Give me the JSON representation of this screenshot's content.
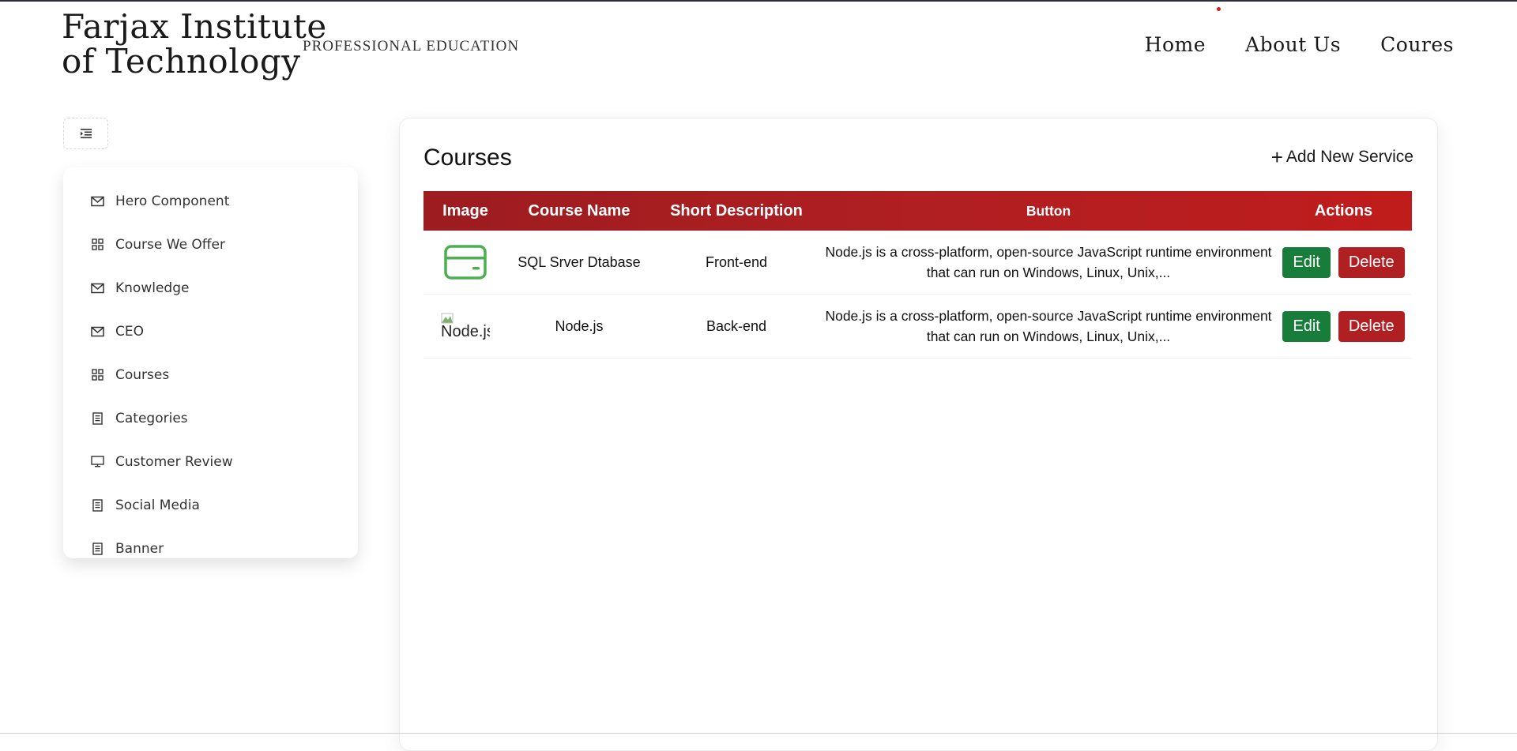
{
  "header": {
    "brand_line1": "Farjax Institute",
    "brand_line2": "of Technology",
    "tagline": "PROFESSIONAL EDUCATION",
    "nav": [
      "Home",
      "About Us",
      "Coures"
    ]
  },
  "sidebar": {
    "items": [
      {
        "label": "Hero Component",
        "icon": "mail-icon"
      },
      {
        "label": "Course We Offer",
        "icon": "grid-icon"
      },
      {
        "label": "Knowledge",
        "icon": "mail-icon"
      },
      {
        "label": "CEO",
        "icon": "mail-icon"
      },
      {
        "label": "Courses",
        "icon": "grid-icon"
      },
      {
        "label": "Categories",
        "icon": "document-icon"
      },
      {
        "label": "Customer Review",
        "icon": "monitor-icon"
      },
      {
        "label": "Social Media",
        "icon": "document-icon"
      },
      {
        "label": "Banner",
        "icon": "document-icon"
      }
    ]
  },
  "main": {
    "title": "Courses",
    "add_label": "Add New Service",
    "columns": [
      "Image",
      "Course Name",
      "Short Description",
      "Button",
      "Actions"
    ],
    "rows": [
      {
        "image": "credit-card-icon",
        "course_name": "SQL Srver Dtabase",
        "short_description": "Front-end",
        "button": "Node.js is a cross-platform, open-source JavaScript runtime environment that can run on Windows, Linux, Unix,...",
        "edit": "Edit",
        "delete": "Delete"
      },
      {
        "image_alt": "Node.js",
        "course_name": "Node.js",
        "short_description": "Back-end",
        "button": "Node.js is a cross-platform, open-source JavaScript runtime environment that can run on Windows, Linux, Unix,...",
        "edit": "Edit",
        "delete": "Delete"
      }
    ]
  },
  "colors": {
    "header_red": "#b01f22",
    "edit_green": "#187c3a",
    "card_icon_green": "#4caf50"
  }
}
